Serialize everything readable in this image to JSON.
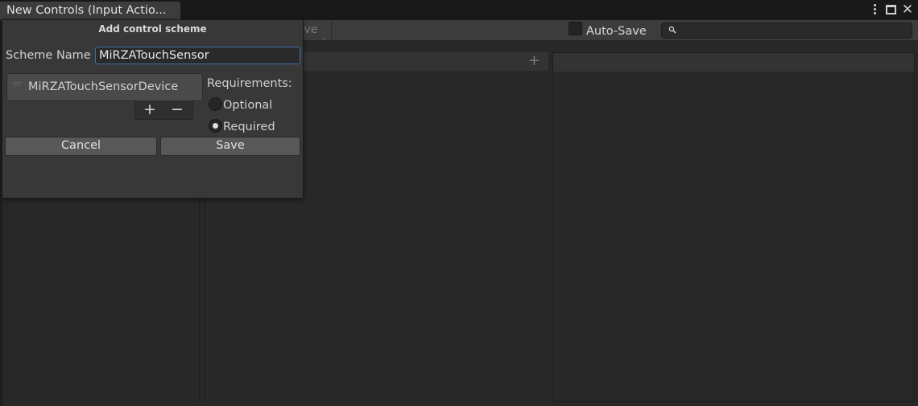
{
  "window": {
    "tab_title": "New Controls (Input Actio...",
    "close_glyph": "✕"
  },
  "toolbar": {
    "save_asset_label": "Save Asset",
    "autosave_label": "Auto-Save",
    "autosave_checked": false,
    "search_value": "",
    "search_icon": "magnifier-icon"
  },
  "panes": {
    "actions_add_glyph": "+"
  },
  "dialog": {
    "title": "Add control scheme",
    "scheme_name_label": "Scheme Name",
    "scheme_name_value": "MiRZATouchSensor",
    "devices": [
      "MiRZATouchSensorDevice"
    ],
    "add_glyph": "+",
    "remove_glyph": "−",
    "requirements_label": "Requirements:",
    "options": [
      {
        "label": "Optional",
        "selected": false
      },
      {
        "label": "Required",
        "selected": true
      }
    ],
    "cancel_label": "Cancel",
    "save_label": "Save"
  },
  "colors": {
    "background": "#282828",
    "panel": "#3c3c3c",
    "dialog": "#383838",
    "input_focus_border": "#3d6ea7"
  }
}
